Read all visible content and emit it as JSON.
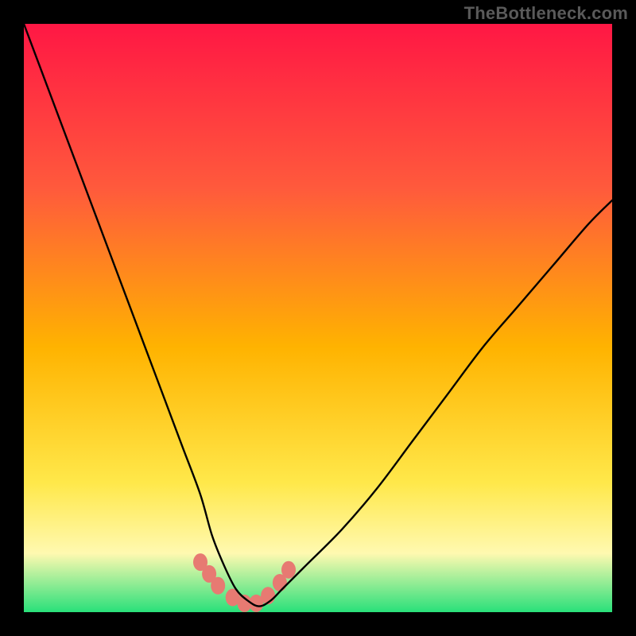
{
  "watermark": "TheBottleneck.com",
  "colors": {
    "frame": "#000000",
    "curve": "#000000",
    "marker": "#e77a72",
    "grad_top": "#ff1744",
    "grad_upper": "#ff5a3c",
    "grad_mid": "#ffb300",
    "grad_lower": "#ffe84a",
    "grad_band": "#fff9b0",
    "grad_bottom": "#29e07a"
  },
  "chart_data": {
    "type": "line",
    "title": "",
    "xlabel": "",
    "ylabel": "",
    "xlim": [
      0,
      100
    ],
    "ylim": [
      0,
      100
    ],
    "series": [
      {
        "name": "bottleneck-curve",
        "x": [
          0,
          3,
          6,
          9,
          12,
          15,
          18,
          21,
          24,
          27,
          30,
          32,
          34,
          36,
          38,
          40,
          42,
          44,
          48,
          54,
          60,
          66,
          72,
          78,
          84,
          90,
          96,
          100
        ],
        "y": [
          100,
          92,
          84,
          76,
          68,
          60,
          52,
          44,
          36,
          28,
          20,
          13,
          8,
          4,
          2,
          1,
          2,
          4,
          8,
          14,
          21,
          29,
          37,
          45,
          52,
          59,
          66,
          70
        ]
      }
    ],
    "markers": {
      "name": "highlight-band",
      "x": [
        30,
        31.5,
        33,
        35.5,
        37.5,
        39.5,
        41.5,
        43.5,
        45
      ],
      "y": [
        8.5,
        6.5,
        4.5,
        2.5,
        1.5,
        1.5,
        2.8,
        5,
        7.2
      ]
    }
  }
}
